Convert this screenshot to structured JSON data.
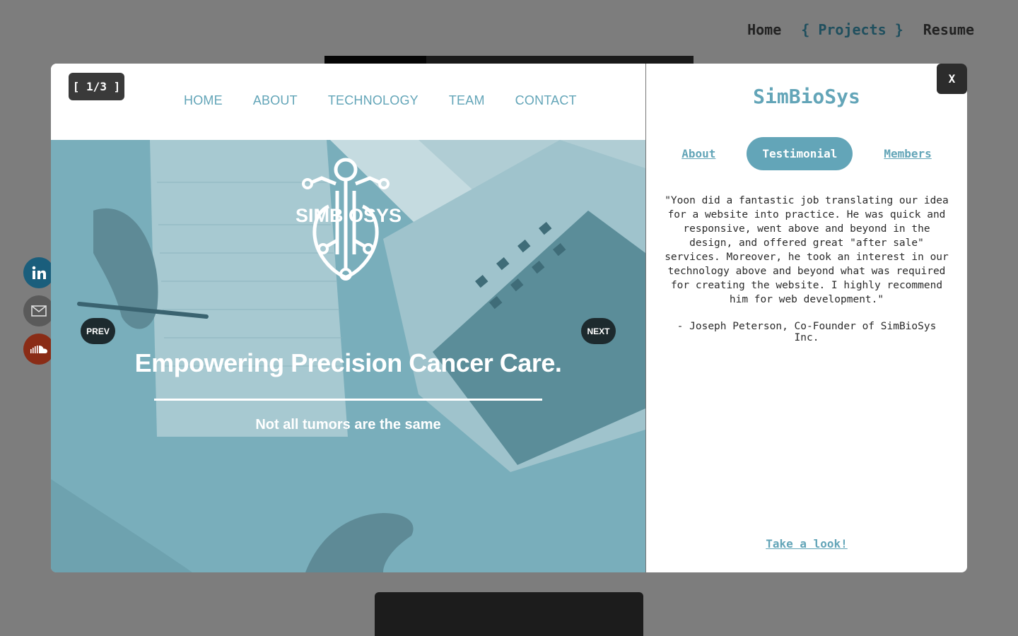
{
  "topnav": {
    "home": "Home",
    "projects": "{ Projects }",
    "resume": "Resume"
  },
  "social": [
    "linkedin-icon",
    "email-icon",
    "soundcloud-icon"
  ],
  "modal": {
    "counter": "[ 1/3 ]",
    "site_nav": [
      "HOME",
      "ABOUT",
      "TECHNOLOGY",
      "TEAM",
      "CONTACT"
    ],
    "hero": {
      "logo_text": "SIMBIOSYS",
      "title": "Empowering Precision Cancer Care.",
      "subtitle": "Not all tumors are the same"
    },
    "prev_label": "PREV",
    "next_label": "NEXT",
    "close_label": "X",
    "project_title": "SimBioSys",
    "tabs": [
      {
        "label": "About",
        "active": false
      },
      {
        "label": "Testimonial",
        "active": true
      },
      {
        "label": "Members",
        "active": false
      }
    ],
    "quote": "\"Yoon did a fantastic job translating our idea for a website into practice. He was quick and responsive, went above and beyond in the design, and offered great \"after sale\" services. Moreover, he took an interest in our technology above and beyond what was required for creating the website. I highly recommend him for web development.\"",
    "author": "- Joseph Peterson, Co-Founder of SimBioSys Inc.",
    "cta": "Take a look!"
  },
  "colors": {
    "accent": "#63a5b8",
    "overlay": "#7d7d7d",
    "dark_button": "#2c2c2c"
  }
}
